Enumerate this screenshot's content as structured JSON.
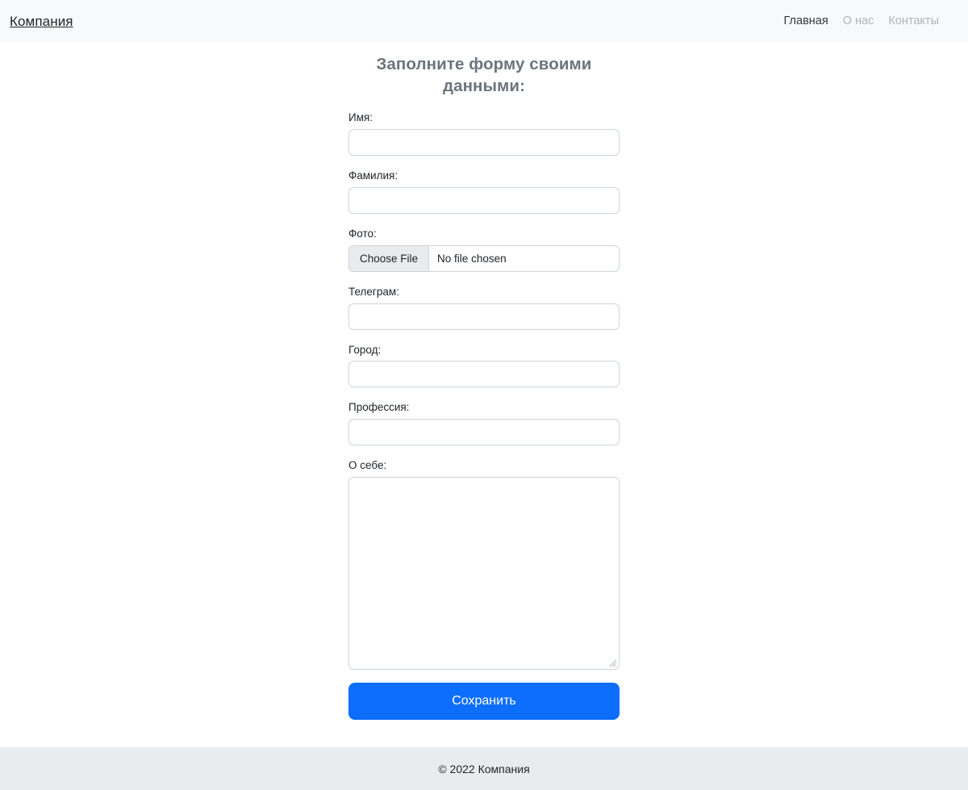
{
  "header": {
    "brand": "Компания",
    "nav": [
      {
        "label": "Главная",
        "active": true
      },
      {
        "label": "О нас",
        "active": false
      },
      {
        "label": "Контакты",
        "active": false
      }
    ]
  },
  "main": {
    "title": "Заполните форму своими данными:",
    "fields": [
      {
        "label": "Имя:",
        "type": "text",
        "value": "",
        "placeholder": ""
      },
      {
        "label": "Фамилия:",
        "type": "text",
        "value": "",
        "placeholder": ""
      },
      {
        "label": "Фото:",
        "type": "file",
        "button_label": "Choose File",
        "file_status": "No file chosen"
      },
      {
        "label": "Телеграм:",
        "type": "text",
        "value": "",
        "placeholder": ""
      },
      {
        "label": "Город:",
        "type": "text",
        "value": "",
        "placeholder": ""
      },
      {
        "label": "Профессия:",
        "type": "text",
        "value": "",
        "placeholder": ""
      },
      {
        "label": "О себе:",
        "type": "textarea",
        "value": "",
        "placeholder": ""
      }
    ],
    "submit_label": "Сохранить"
  },
  "footer": {
    "copyright": "© 2022 Компания"
  },
  "colors": {
    "header_bg": "#f8f9fa",
    "footer_bg": "#e9ecef",
    "accent": "#0d6efd",
    "title": "#6c757d",
    "muted_link": "#adb5bd",
    "active_link": "#343a40",
    "input_border": "#ced4da"
  }
}
